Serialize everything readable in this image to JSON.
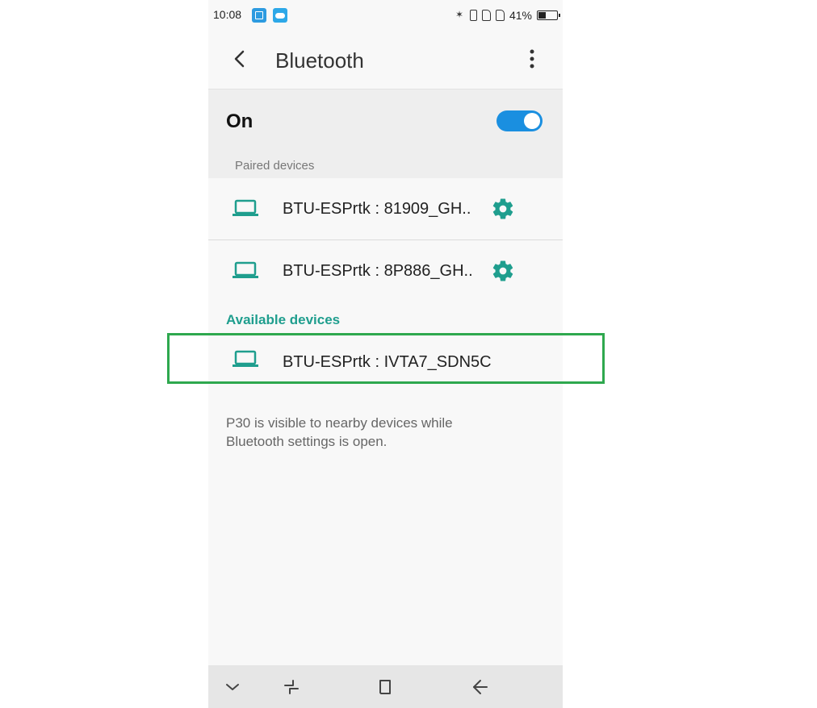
{
  "status_bar": {
    "time": "10:08",
    "battery_percent": "41%",
    "battery_level": 0.41,
    "icons": [
      "screenshot-notification-icon",
      "weather-notification-icon",
      "bluetooth-icon",
      "vibrate-icon",
      "sim-icon",
      "sim-icon",
      "battery-icon"
    ]
  },
  "app_bar": {
    "title": "Bluetooth",
    "back_icon": "back-arrow-icon",
    "menu_icon": "more-vert-icon"
  },
  "master_switch": {
    "label": "On",
    "checked": true,
    "accent_color": "#1a8fe0"
  },
  "paired": {
    "header": "Paired devices",
    "devices": [
      {
        "name": "BTU-ESPrtk : 81909_GH..",
        "icon": "laptop-icon",
        "settings_icon": "gear-icon"
      },
      {
        "name": "BTU-ESPrtk : 8P886_GH..",
        "icon": "laptop-icon",
        "settings_icon": "gear-icon"
      }
    ]
  },
  "available": {
    "header": "Available devices",
    "devices": [
      {
        "name": "BTU-ESPrtk : IVTA7_SDN5C",
        "icon": "laptop-icon"
      }
    ]
  },
  "footer": {
    "text": "P30 is visible to nearby devices while Bluetooth settings is open."
  },
  "nav_bar": {
    "icons": [
      "chevron-down-icon",
      "recents-icon",
      "home-icon",
      "back-icon"
    ]
  },
  "colors": {
    "teal": "#1f9e8e",
    "highlight": "#2ea84e"
  }
}
